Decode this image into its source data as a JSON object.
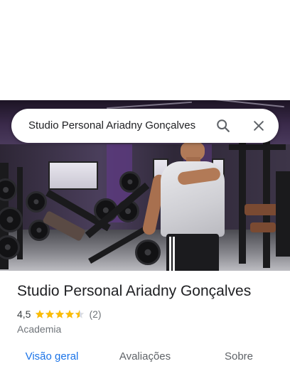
{
  "search": {
    "query": "Studio Personal Ariadny Gonçalves",
    "search_icon": "search-icon",
    "close_icon": "close-icon"
  },
  "place": {
    "name": "Studio Personal Ariadny Gonçalves",
    "rating": "4,5",
    "rating_stars": 4.5,
    "review_count": "(2)",
    "category": "Academia"
  },
  "tabs": [
    {
      "label": "Visão geral",
      "active": true
    },
    {
      "label": "Avaliações",
      "active": false
    },
    {
      "label": "Sobre",
      "active": false
    }
  ],
  "colors": {
    "accent": "#1a73e8",
    "star": "#fbbc04",
    "text_primary": "#202124",
    "text_secondary": "#70757a"
  }
}
